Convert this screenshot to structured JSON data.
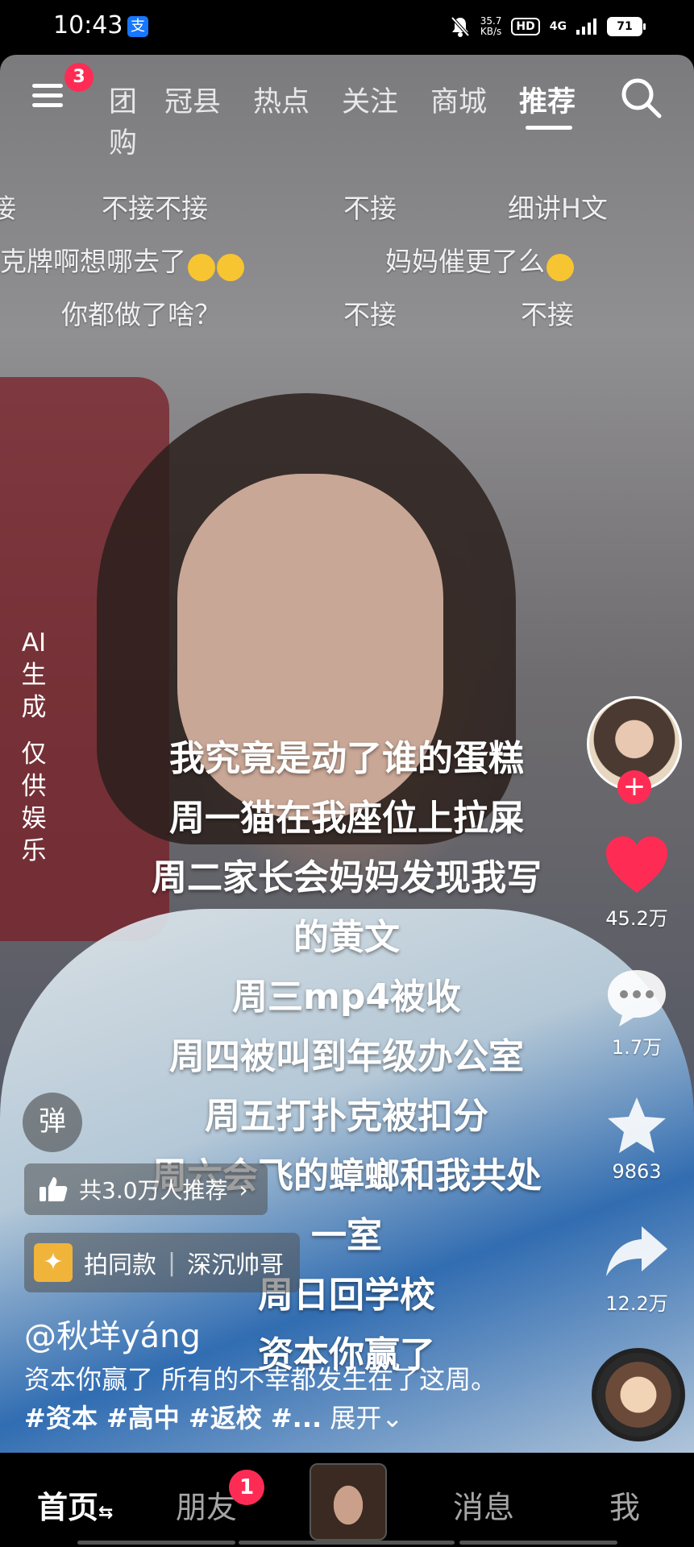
{
  "status_bar": {
    "time": "10:43",
    "pay_icon_char": "支",
    "net_speed_value": "35.7",
    "net_speed_unit": "KB/s",
    "hd": "HD",
    "signal": "4G",
    "battery": "71"
  },
  "top_nav": {
    "menu_badge": "3",
    "tabs": [
      {
        "label": "团购"
      },
      {
        "label": "冠县"
      },
      {
        "label": "热点"
      },
      {
        "label": "关注"
      },
      {
        "label": "商城"
      },
      {
        "label": "推荐"
      }
    ]
  },
  "danmaku": {
    "row1": [
      "接",
      "不接不接",
      "不接",
      "细讲H文"
    ],
    "row2": [
      "克牌啊想哪去了",
      "妈妈催更了么"
    ],
    "row3": [
      "你都做了啥？",
      "不接",
      "不接"
    ]
  },
  "ai_label": [
    "AI",
    "生",
    "成",
    "仅",
    "供",
    "娱",
    "乐"
  ],
  "caption_lines": [
    "我究竟是动了谁的蛋糕",
    "周一猫在我座位上拉屎",
    "周二家长会妈妈发现我写",
    "的黄文",
    "周三mp4被收",
    "周四被叫到年级办公室",
    "周五打扑克被扣分",
    "周六会飞的蟑螂和我共处",
    "一室",
    "周日回学校",
    "资本你赢了"
  ],
  "right_rail": {
    "likes": "45.2万",
    "comments": "1.7万",
    "favorites": "9863",
    "shares": "12.2万"
  },
  "danmu_toggle": "弹",
  "recommend_pill": "共3.0万人推荐",
  "same_style": {
    "label": "拍同款",
    "creator": "深沉帅哥"
  },
  "author": "@秋垟yáng",
  "description": {
    "text": "资本你赢了 所有的不幸都发生在了这周。",
    "tags": "#资本 #高中 #返校 #...",
    "expand": "展开"
  },
  "bottom_nav": {
    "home": "首页",
    "friends": "朋友",
    "friends_badge": "1",
    "messages": "消息",
    "me": "我"
  }
}
